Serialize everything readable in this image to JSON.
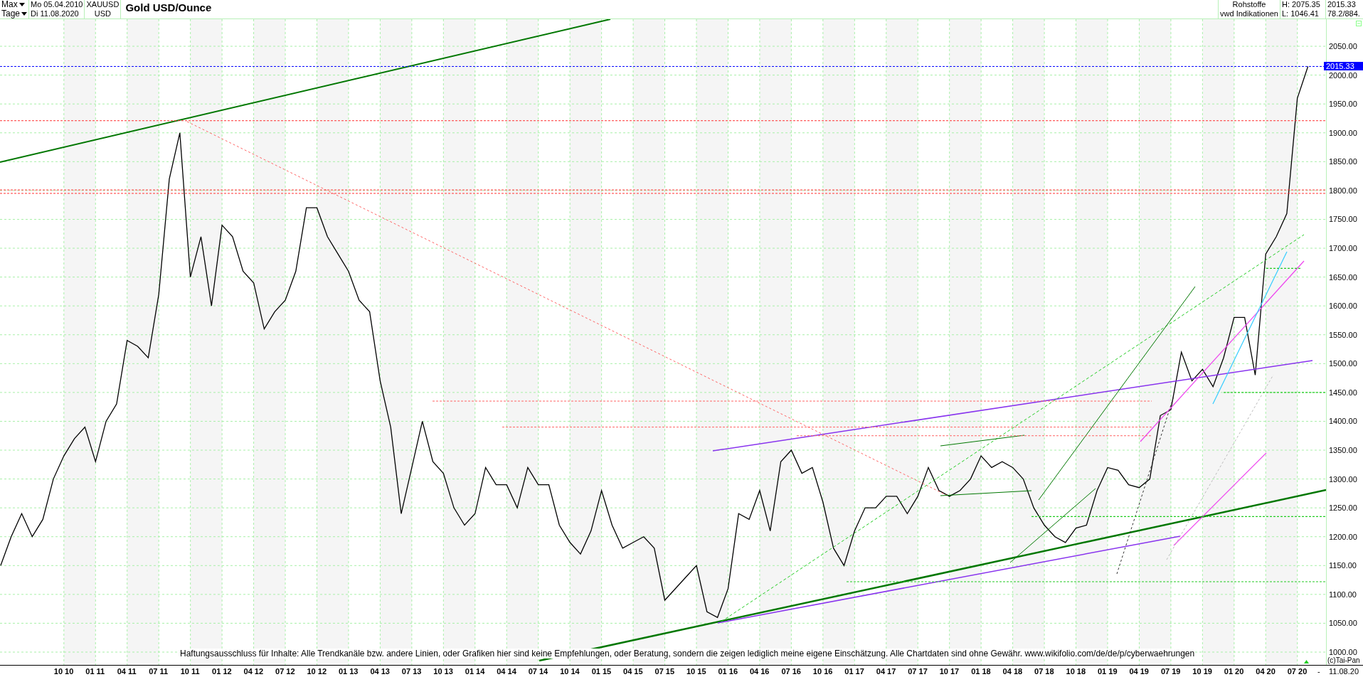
{
  "header": {
    "range": {
      "label": "Max"
    },
    "interval": {
      "label": "Tage"
    },
    "start_date": "Mo 05.04.2010",
    "end_date": "Di 11.08.2020",
    "symbol": "XAUUSD",
    "currency": "USD",
    "title": "Gold USD/Ounce",
    "category": "Rohstoffe",
    "source": "vwd Indikationen",
    "high": "H: 2075.35",
    "low": "L: 1046.41",
    "last": "2015.33",
    "ratio": "78.2/884."
  },
  "chart": {
    "chart_data": {
      "type": "line",
      "grid": true,
      "ylim": [
        977.8,
        2096.9
      ],
      "categories": [
        null,
        null,
        null,
        null,
        null,
        null,
        "10 10",
        null,
        null,
        "01 11",
        null,
        null,
        "04 11",
        null,
        null,
        "07 11",
        null,
        null,
        "10 11",
        null,
        null,
        "01 12",
        null,
        null,
        "04 12",
        null,
        null,
        "07 12",
        null,
        null,
        "10 12",
        null,
        null,
        "01 13",
        null,
        null,
        "04 13",
        null,
        null,
        "07 13",
        null,
        null,
        "10 13",
        null,
        null,
        "01 14",
        null,
        null,
        "04 14",
        null,
        null,
        "07 14",
        null,
        null,
        "10 14",
        null,
        null,
        "01 15",
        null,
        null,
        "04 15",
        null,
        null,
        "07 15",
        null,
        null,
        "10 15",
        null,
        null,
        "01 16",
        null,
        null,
        "04 16",
        null,
        null,
        "07 16",
        null,
        null,
        "10 16",
        null,
        null,
        "01 17",
        null,
        null,
        "04 17",
        null,
        null,
        "07 17",
        null,
        null,
        "10 17",
        null,
        null,
        "01 18",
        null,
        null,
        "04 18",
        null,
        null,
        "07 18",
        null,
        null,
        "10 18",
        null,
        null,
        "01 19",
        null,
        null,
        "04 19",
        null,
        null,
        "07 19",
        null,
        null,
        "10 19",
        null,
        null,
        "01 20",
        null,
        null,
        "04 20",
        null,
        null,
        "07 20",
        null
      ],
      "series": [
        {
          "color": "#000000",
          "values": [
            1150,
            1200,
            1240,
            1200,
            1230,
            1300,
            1340,
            1370,
            1390,
            1330,
            1400,
            1430,
            1540,
            1530,
            1510,
            1620,
            1820,
            1900,
            1650,
            1720,
            1600,
            1740,
            1720,
            1660,
            1640,
            1560,
            1590,
            1610,
            1660,
            1770,
            1770,
            1720,
            1690,
            1660,
            1610,
            1590,
            1470,
            1390,
            1240,
            1320,
            1400,
            1330,
            1310,
            1250,
            1220,
            1240,
            1320,
            1290,
            1290,
            1250,
            1320,
            1290,
            1290,
            1220,
            1190,
            1170,
            1210,
            1280,
            1220,
            1180,
            1190,
            1200,
            1180,
            1090,
            1110,
            1130,
            1150,
            1070,
            1060,
            1110,
            1240,
            1230,
            1280,
            1210,
            1330,
            1350,
            1310,
            1320,
            1260,
            1180,
            1150,
            1210,
            1250,
            1250,
            1270,
            1270,
            1240,
            1270,
            1320,
            1280,
            1270,
            1280,
            1300,
            1340,
            1320,
            1330,
            1320,
            1300,
            1250,
            1220,
            1200,
            1190,
            1215,
            1220,
            1280,
            1320,
            1315,
            1290,
            1285,
            1300,
            1410,
            1420,
            1520,
            1470,
            1490,
            1460,
            1510,
            1580,
            1580,
            1480,
            1690,
            1720,
            1760,
            1960,
            2015
          ]
        }
      ],
      "yticks": [
        {
          "value": 1000,
          "label": "1000.00"
        },
        {
          "value": 1050,
          "label": "1050.00"
        },
        {
          "value": 1100,
          "label": "1100.00"
        },
        {
          "value": 1150,
          "label": "1150.00"
        },
        {
          "value": 1200,
          "label": "1200.00"
        },
        {
          "value": 1250,
          "label": "1250.00"
        },
        {
          "value": 1300,
          "label": "1300.00"
        },
        {
          "value": 1350,
          "label": "1350.00"
        },
        {
          "value": 1400,
          "label": "1400.00"
        },
        {
          "value": 1450,
          "label": "1450.00"
        },
        {
          "value": 1500,
          "label": "1500.00"
        },
        {
          "value": 1550,
          "label": "1550.00"
        },
        {
          "value": 1600,
          "label": "1600.00"
        },
        {
          "value": 1650,
          "label": "1650.00"
        },
        {
          "value": 1700,
          "label": "1700.00"
        },
        {
          "value": 1750,
          "label": "1750.00"
        },
        {
          "value": 1800,
          "label": "1800.00"
        },
        {
          "value": 1850,
          "label": "1850.00"
        },
        {
          "value": 1900,
          "label": "1900.00"
        },
        {
          "value": 1950,
          "label": "1950.00"
        },
        {
          "value": 2000,
          "label": "2000.00"
        },
        {
          "value": 2050,
          "label": "2050.00"
        }
      ]
    },
    "price_marker": "2015.33",
    "disclaimer": "Haftungsausschluss für Inhalte: Alle Trendkanäle bzw. andere Linien, oder Grafiken hier sind keine Empfehlungen, oder Beratung, sondern die zeigen lediglich meine eigene Einschätzung. Alle Chartdaten sind ohne Gewähr.  www.wikifolio.com/de/de/p/cyberwaehrungen",
    "x_axis_end": [
      "-",
      "11.08.20"
    ],
    "copyright": "(c)Tai-Pan"
  }
}
